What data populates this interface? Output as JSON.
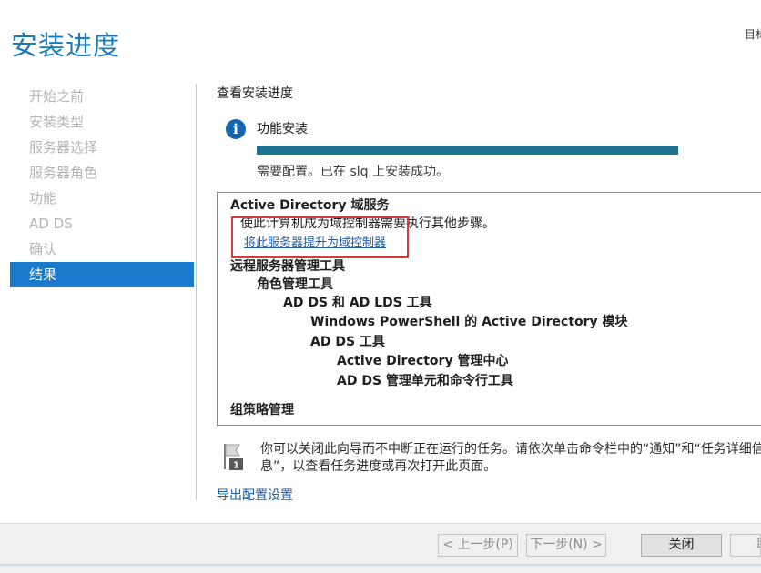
{
  "header": {
    "title": "安装进度",
    "top_right_text": "目标"
  },
  "nav": {
    "items": [
      {
        "label": "开始之前",
        "active": false
      },
      {
        "label": "安装类型",
        "active": false
      },
      {
        "label": "服务器选择",
        "active": false
      },
      {
        "label": "服务器角色",
        "active": false
      },
      {
        "label": "功能",
        "active": false
      },
      {
        "label": "AD DS",
        "active": false
      },
      {
        "label": "确认",
        "active": false
      },
      {
        "label": "结果",
        "active": true
      }
    ]
  },
  "content": {
    "heading": "查看安装进度",
    "info_icon": "info-icon",
    "feature_title": "功能安装",
    "progress_fraction": 1.0,
    "status": "需要配置。已在 slq 上安装成功。",
    "results": {
      "ad_ds_title": "Active Directory 域服务",
      "ad_ds_desc": "使此计算机成为域控制器需要执行其他步骤。",
      "promote_link": "将此服务器提升为域控制器",
      "rsat": "远程服务器管理工具",
      "role_tools": "角色管理工具",
      "adds_adlds_tools": "AD DS 和 AD LDS 工具",
      "ps_module": "Windows PowerShell 的 Active Directory 模块",
      "adds_tools": "AD DS 工具",
      "admin_center": "Active Directory 管理中心",
      "snapins": "AD DS 管理单元和命令行工具",
      "gpm": "组策略管理"
    },
    "note": "你可以关闭此向导而不中断正在运行的任务。请依次单击命令栏中的“通知”和“任务详细信息”，以查看任务进度或再次打开此页面。",
    "export_link": "导出配置设置"
  },
  "footer": {
    "prev_label": "< 上一步(P)",
    "next_label": "下一步(N) >",
    "close_label": "关闭",
    "cancel_label": "取消"
  },
  "colors": {
    "title": "#1b7ab8",
    "nav_active_bg": "#1979ca",
    "progress_fill": "#1e7290",
    "highlight_border": "#d63a3a",
    "link": "#1f5fa8"
  }
}
